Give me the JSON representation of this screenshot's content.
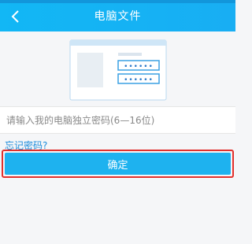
{
  "header": {
    "title": "电脑文件",
    "back_icon": "chevron-left-icon",
    "color": "#12b7f5"
  },
  "illustration": {
    "name": "login-window-illustration",
    "password_mask": "••••••"
  },
  "form": {
    "password_placeholder": "请输入我的电脑独立密码(6—16位)",
    "password_value": "",
    "forgot_link": "忘记密码?",
    "confirm_label": "确定",
    "confirm_color": "#1eb2ef",
    "highlight_color": "#e2312d"
  }
}
